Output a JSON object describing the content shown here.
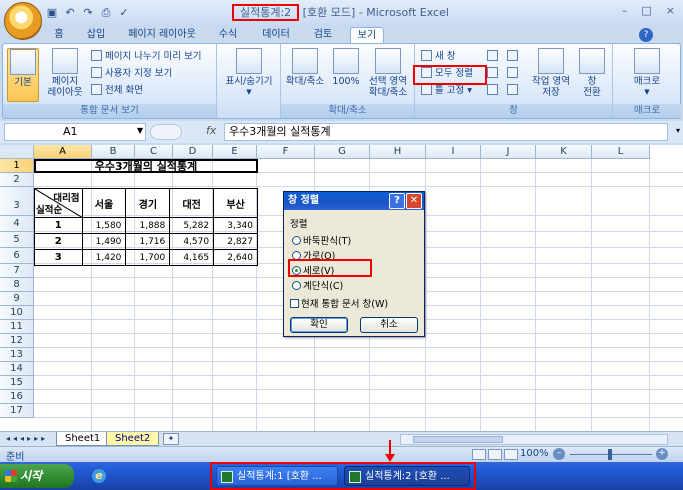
{
  "window": {
    "title_workbook": "실적통계:2",
    "title_rest": " [호환 모드] - Microsoft Excel",
    "qat_icons": [
      "save-icon",
      "undo-icon",
      "redo-icon",
      "print-preview-icon",
      "spellcheck-icon"
    ],
    "controls": [
      "–",
      "□",
      "×"
    ]
  },
  "ribbon": {
    "tabs": [
      "홈",
      "삽입",
      "페이지 레이아웃",
      "수식",
      "데이터",
      "검토",
      "보기"
    ],
    "active_tab": "보기",
    "groups": {
      "workbook_views": {
        "label": "통합 문서 보기",
        "normal": "기본",
        "page_layout_line1": "페이지",
        "page_layout_line2": "레이아웃",
        "page_break_preview": "페이지 나누기 미리 보기",
        "custom_views": "사용자 지정 보기",
        "full_screen": "전체 화면"
      },
      "show_hide": {
        "label": "표시/숨기기"
      },
      "zoom": {
        "label": "확대/축소",
        "zoom": "확대/축소",
        "hundred": "100%",
        "selection_line1": "선택 영역",
        "selection_line2": "확대/축소"
      },
      "window": {
        "label": "창",
        "new_window": "새 창",
        "arrange_all": "모두 정렬",
        "freeze_panes": "틀 고정",
        "save_workspace_line1": "작업 영역",
        "save_workspace_line2": "저장",
        "switch_windows_line1": "창",
        "switch_windows_line2": "전환"
      },
      "macros": {
        "label": "매크로",
        "macros": "매크로"
      }
    }
  },
  "formula_bar": {
    "name_box": "A1",
    "fx": "fx",
    "value": "우수3개월의 실적통계"
  },
  "grid": {
    "columns": [
      "A",
      "B",
      "C",
      "D",
      "E",
      "F",
      "G",
      "H",
      "I",
      "J",
      "K",
      "L"
    ],
    "rows": [
      "1",
      "2",
      "3",
      "4",
      "5",
      "6",
      "7",
      "8",
      "9",
      "10",
      "11",
      "12",
      "13",
      "14",
      "15",
      "16",
      "17"
    ],
    "title": "우수3개월의 실적통계",
    "header_diag_top": "대리점",
    "header_diag_bottom": "실적순",
    "headers": [
      "서울",
      "경기",
      "대전",
      "부산"
    ],
    "table_rows": [
      {
        "rank": "1",
        "values": [
          "1,580",
          "1,888",
          "5,282",
          "3,340"
        ]
      },
      {
        "rank": "2",
        "values": [
          "1,490",
          "1,716",
          "4,570",
          "2,827"
        ]
      },
      {
        "rank": "3",
        "values": [
          "1,420",
          "1,700",
          "4,165",
          "2,640"
        ]
      }
    ]
  },
  "dialog": {
    "title": "창 정렬",
    "section": "정렬",
    "options": [
      "바둑판식(T)",
      "가로(O)",
      "세로(V)",
      "계단식(C)"
    ],
    "selected": "세로(V)",
    "checkbox": "현재 통합 문서 창(W)",
    "ok": "확인",
    "cancel": "취소"
  },
  "sheets": {
    "tabs": [
      "Sheet1",
      "Sheet2"
    ]
  },
  "status": {
    "text": "준비",
    "zoom": "100%"
  },
  "taskbar": {
    "start": "시작",
    "tasks": [
      "실적통계:1 [호환 ...",
      "실적통계:2 [호환 ..."
    ]
  },
  "colors": {
    "highlight": "#e00000",
    "ribbon_blue": "#15428b"
  }
}
